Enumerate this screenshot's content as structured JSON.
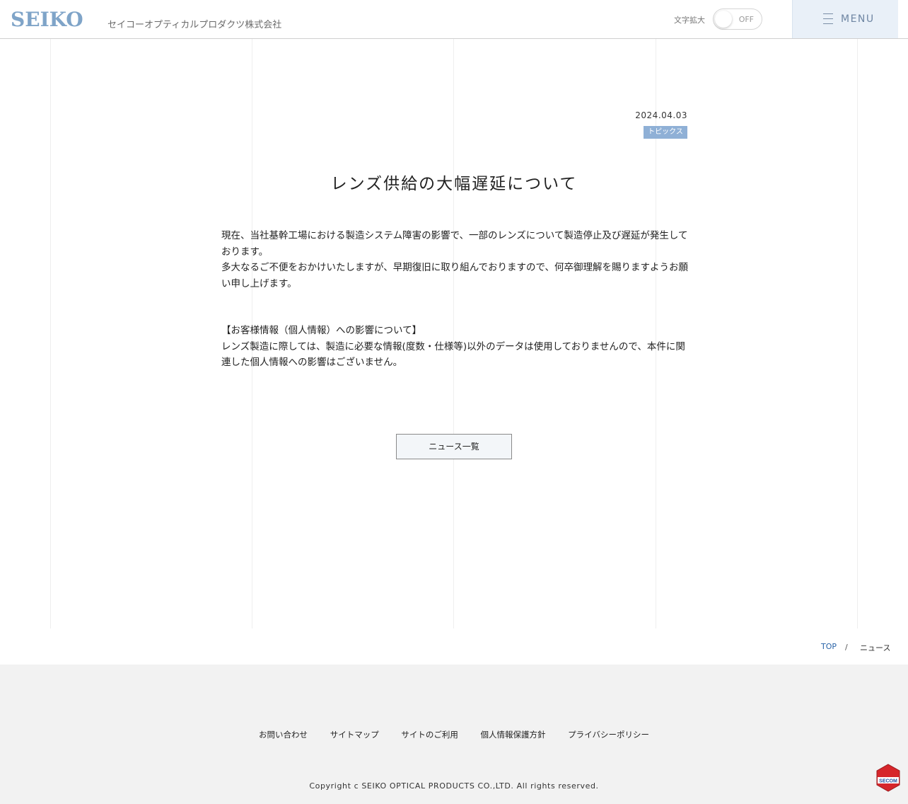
{
  "header": {
    "logo": "SEIKO",
    "company": "セイコーオプティカルプロダクツ株式会社",
    "zoom_label": "文字拡大",
    "zoom_state": "OFF",
    "menu_label": "MENU"
  },
  "article": {
    "date": "2024.04.03",
    "tag": "トピックス",
    "title": "レンズ供給の大幅遅延について",
    "paragraph1_line1": "現在、当社基幹工場における製造システム障害の影響で、一部のレンズについて製造停止及び遅延が発生しております。",
    "paragraph1_line2": "多大なるご不便をおかけいたしますが、早期復旧に取り組んでおりますので、何卒御理解を賜りますようお願い申し上げます。",
    "paragraph2_heading": "【お客様情報（個人情報）への影響について】",
    "paragraph2_body": "レンズ製造に際しては、製造に必要な情報(度数・仕様等)以外のデータは使用しておりませんので、本件に関連した個人情報への影響はございません。",
    "news_list_button": "ニュース一覧"
  },
  "breadcrumb": {
    "top": "TOP",
    "separator": "/",
    "current": "ニュース"
  },
  "footer": {
    "links": [
      "お問い合わせ",
      "サイトマップ",
      "サイトのご利用",
      "個人情報保護方針",
      "プライバシーポリシー"
    ],
    "copyright": "Copyright c SEIKO OPTICAL PRODUCTS CO.,LTD. All rights reserved.",
    "secom_badge": "SECOM"
  },
  "colors": {
    "brand": "#7fa4c8",
    "tag_bg": "#8fb0d6",
    "menu_bg": "#e9f0f8",
    "link": "#2a64a8",
    "footer_bg": "#f2f2f2"
  }
}
